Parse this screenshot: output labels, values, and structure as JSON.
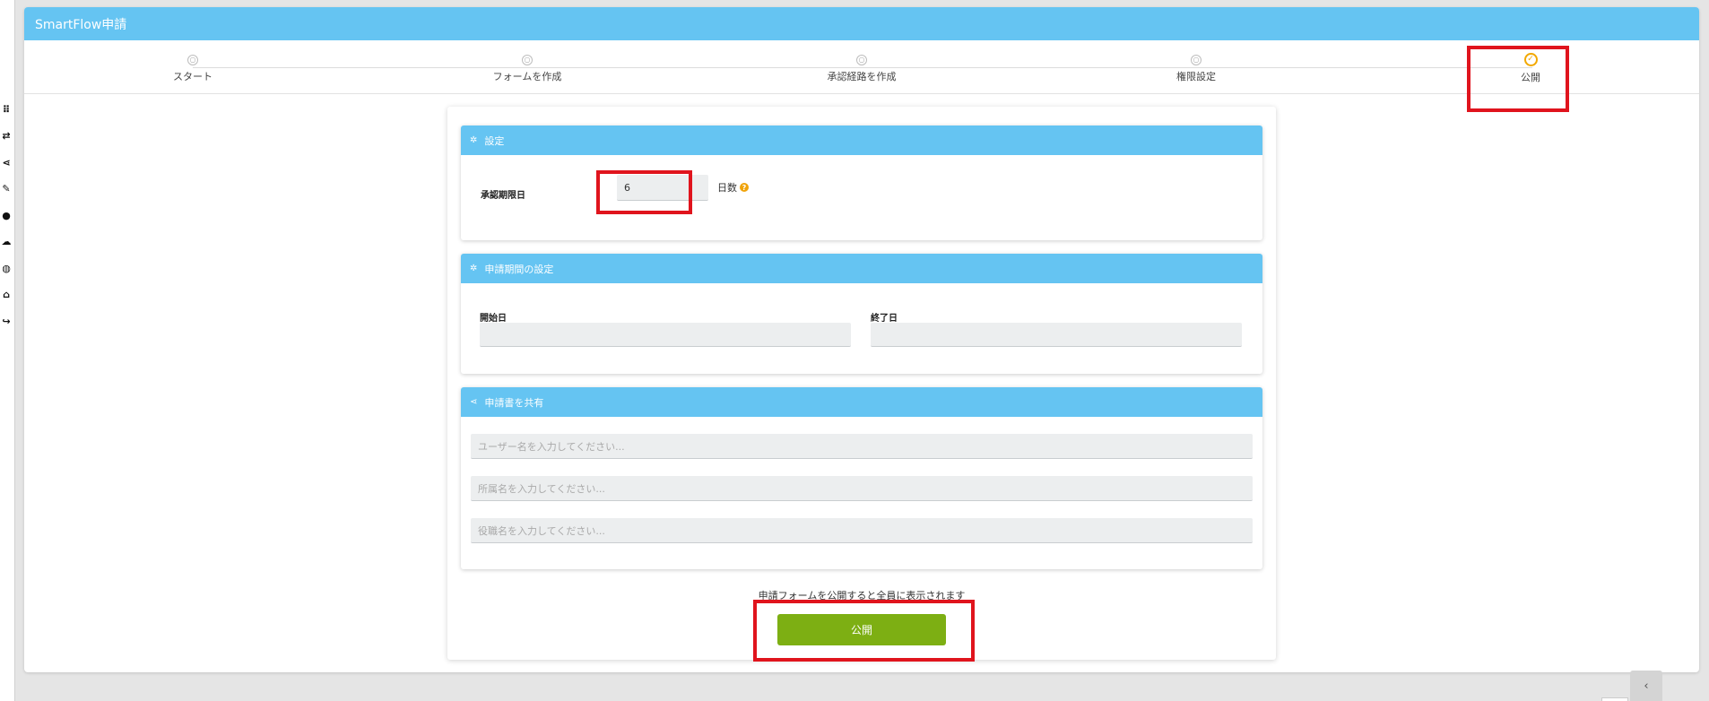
{
  "app": {
    "title": "SmartFlow申請"
  },
  "left_rail": {
    "icons": [
      "grid-icon",
      "link-icon",
      "share-icon",
      "pencil-icon",
      "user-icon",
      "cloud-icon",
      "globe-icon",
      "building-icon",
      "logout-icon"
    ]
  },
  "stepper": {
    "steps": [
      {
        "label": "スタート",
        "state": "pending"
      },
      {
        "label": "フォームを作成",
        "state": "pending"
      },
      {
        "label": "承認経路を作成",
        "state": "pending"
      },
      {
        "label": "権限設定",
        "state": "pending"
      },
      {
        "label": "公開",
        "state": "complete"
      }
    ]
  },
  "settings_card": {
    "title": "設定",
    "approval_deadline_label": "承認期限日",
    "approval_deadline_value": "6",
    "unit": "日数"
  },
  "period_card": {
    "title": "申請期間の設定",
    "start_label": "開始日",
    "start_value": "",
    "end_label": "終了日",
    "end_value": ""
  },
  "share_card": {
    "title": "申請書を共有",
    "user_placeholder": "ユーザー名を入力してください...",
    "department_placeholder": "所属名を入力してください...",
    "position_placeholder": "役職名を入力してください..."
  },
  "publish": {
    "notice": "申請フォームを公開すると全員に表示されます",
    "button_label": "公開"
  },
  "colors": {
    "header": "#65c4f2",
    "publish_button": "#7daf13",
    "highlight": "#e0141d",
    "step_complete": "#f2a800"
  }
}
